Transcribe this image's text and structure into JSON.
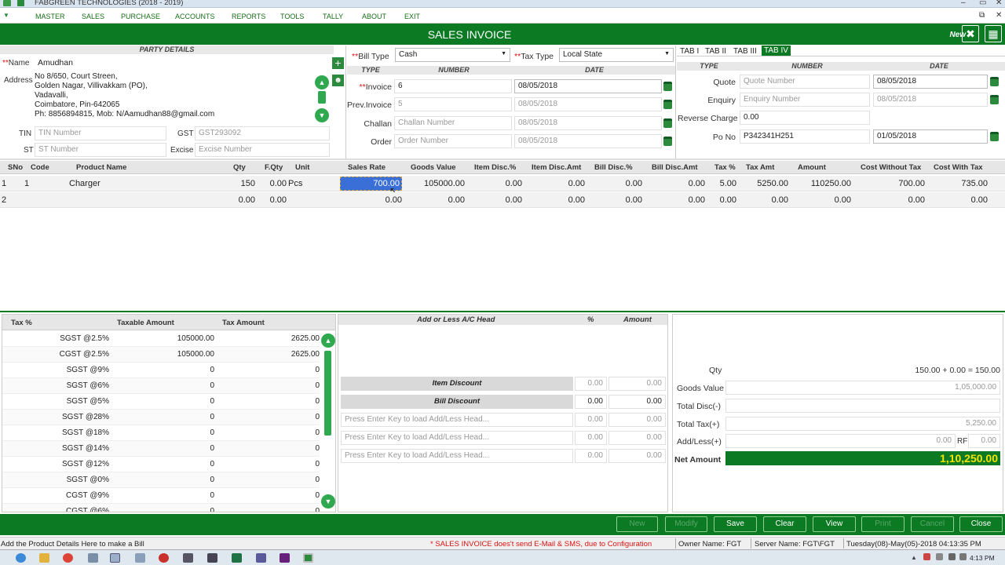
{
  "window": {
    "title": "FABGREEN TECHNOLOGIES (2018 - 2019)"
  },
  "menu": [
    "MASTER",
    "SALES",
    "PURCHASE",
    "ACCOUNTS",
    "REPORTS",
    "TOOLS",
    "TALLY",
    "ABOUT",
    "EXIT"
  ],
  "header": {
    "title": "SALES INVOICE",
    "new_label": "New"
  },
  "party": {
    "section": "PARTY DETAILS",
    "name_label": "Name",
    "name_value": "Amudhan",
    "address_label": "Address",
    "address_lines": [
      "No 8/650, Court Streen,",
      "Golden Nagar, Villivakkam (PO),",
      "Vadavalli,",
      "Coimbatore, Pin-642065",
      "Ph: 8856894815, Mob: N/Aamudhan88@gmail.com"
    ],
    "tin_label": "TIN",
    "tin_placeholder": "TIN Number",
    "gst_label": "GST",
    "gst_placeholder": "GST293092",
    "st_label": "ST",
    "st_placeholder": "ST Number",
    "excise_label": "Excise",
    "excise_placeholder": "Excise Number"
  },
  "bill": {
    "bill_type_label": "Bill Type",
    "bill_type_value": "Cash",
    "tax_type_label": "Tax Type",
    "tax_type_value": "Local State",
    "col_type": "TYPE",
    "col_number": "NUMBER",
    "col_date": "DATE",
    "rows": [
      {
        "label": "Invoice",
        "number": "6",
        "date": "08/05/2018",
        "required": true,
        "placeholder": false
      },
      {
        "label": "Prev.Invoice",
        "number": "5",
        "date": "08/05/2018",
        "required": false,
        "placeholder": true
      },
      {
        "label": "Challan",
        "number": "Challan Number",
        "date": "08/05/2018",
        "required": false,
        "placeholder": true
      },
      {
        "label": "Order",
        "number": "Order Number",
        "date": "08/05/2018",
        "required": false,
        "placeholder": true
      }
    ]
  },
  "tabs": [
    "TAB I",
    "TAB II",
    "TAB III",
    "TAB IV"
  ],
  "active_tab": "TAB IV",
  "tab4": {
    "col_type": "TYPE",
    "col_number": "NUMBER",
    "col_date": "DATE",
    "rows": [
      {
        "label": "Quote",
        "number": "Quote Number",
        "date": "08/05/2018"
      },
      {
        "label": "Enquiry",
        "number": "Enquiry Number",
        "date": "08/05/2018"
      },
      {
        "label": "Reverse Charge",
        "number": "0.00",
        "date": ""
      },
      {
        "label": "Po No",
        "number": "P342341H251",
        "date": "01/05/2018"
      }
    ]
  },
  "product_grid": {
    "columns": [
      "SNo",
      "Code",
      "Product Name",
      "Qty",
      "F.Qty",
      "Unit",
      "Sales Rate",
      "Goods Value",
      "Item Disc.%",
      "Item Disc.Amt",
      "Bill Disc.%",
      "Bill Disc.Amt",
      "Tax %",
      "Tax Amt",
      "Amount",
      "Cost Without Tax",
      "Cost With Tax"
    ],
    "rows": [
      [
        "1",
        "1",
        "Charger",
        "150",
        "0.00",
        "Pcs",
        "700.00",
        "105000.00",
        "0.00",
        "0.00",
        "0.00",
        "0.00",
        "5.00",
        "5250.00",
        "110250.00",
        "700.00",
        "735.00"
      ],
      [
        "2",
        "",
        "",
        "0.00",
        "0.00",
        "",
        "0.00",
        "0.00",
        "0.00",
        "0.00",
        "0.00",
        "0.00",
        "0.00",
        "0.00",
        "0.00",
        "0.00",
        "0.00"
      ]
    ]
  },
  "tax_table": {
    "columns": [
      "Tax %",
      "Taxable Amount",
      "Tax Amount"
    ],
    "rows": [
      [
        "SGST @2.5%",
        "105000.00",
        "2625.00"
      ],
      [
        "CGST @2.5%",
        "105000.00",
        "2625.00"
      ],
      [
        "SGST @9%",
        "0",
        "0"
      ],
      [
        "SGST @6%",
        "0",
        "0"
      ],
      [
        "SGST @5%",
        "0",
        "0"
      ],
      [
        "SGST @28%",
        "0",
        "0"
      ],
      [
        "SGST @18%",
        "0",
        "0"
      ],
      [
        "SGST @14%",
        "0",
        "0"
      ],
      [
        "SGST @12%",
        "0",
        "0"
      ],
      [
        "SGST @0%",
        "0",
        "0"
      ],
      [
        "CGST @9%",
        "0",
        "0"
      ],
      [
        "CGST @6%",
        "0",
        "0"
      ]
    ]
  },
  "addless": {
    "col_head": "Add or Less A/C Head",
    "col_pct": "%",
    "col_amount": "Amount",
    "item_discount": {
      "label": "Item Discount",
      "pct": "0.00",
      "amount": "0.00"
    },
    "bill_discount": {
      "label": "Bill Discount",
      "pct": "0.00",
      "amount": "0.00"
    },
    "heads": [
      {
        "placeholder": "Press Enter Key to load Add/Less Head...",
        "pct": "0.00",
        "amount": "0.00"
      },
      {
        "placeholder": "Press Enter Key to load Add/Less Head...",
        "pct": "0.00",
        "amount": "0.00"
      },
      {
        "placeholder": "Press Enter Key to load Add/Less Head...",
        "pct": "0.00",
        "amount": "0.00"
      }
    ]
  },
  "totals": {
    "qty_label": "Qty",
    "qty_value": "150.00 + 0.00 = 150.00",
    "goods_label": "Goods Value",
    "goods_value": "1,05,000.00",
    "disc_label": "Total Disc(-)",
    "disc_value": "",
    "tax_label": "Total Tax(+)",
    "tax_value": "5,250.00",
    "addless_label": "Add/Less(+)",
    "addless_value": "0.00",
    "rf_label": "RF",
    "rf_value": "0.00",
    "net_label": "Net Amount",
    "net_value": "1,10,250.00"
  },
  "buttons": [
    {
      "label": "New",
      "enabled": false
    },
    {
      "label": "Modify",
      "enabled": false
    },
    {
      "label": "Save",
      "enabled": true
    },
    {
      "label": "Clear",
      "enabled": true
    },
    {
      "label": "View",
      "enabled": true
    },
    {
      "label": "Print",
      "enabled": false
    },
    {
      "label": "Cancel",
      "enabled": false
    },
    {
      "label": "Close",
      "enabled": true
    }
  ],
  "status": {
    "hint": "Add the Product Details Here to make a Bill",
    "warning": "* SALES INVOICE does't send E-Mail & SMS, due to Configuration",
    "owner": "Owner Name: FGT",
    "server": "Server Name: FGT\\FGT",
    "datetime": "Tuesday(08)-May(05)-2018  04:13:35 PM"
  },
  "taskbar": {
    "clock": "4:13 PM"
  },
  "colors": {
    "accent": "#0b7a23",
    "net_amount_text": "#f5e400",
    "required": "#d11111",
    "selected_cell": "#3a6fd8"
  }
}
